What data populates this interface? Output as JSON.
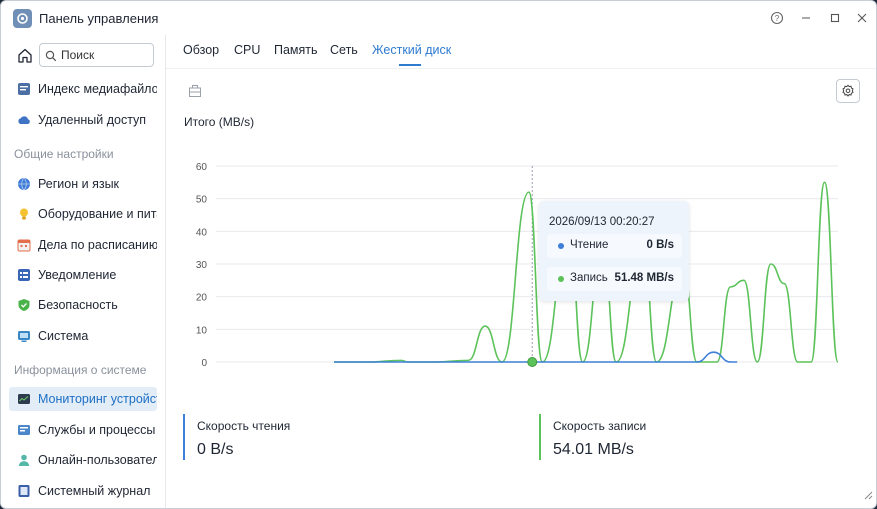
{
  "window": {
    "title": "Панель управления"
  },
  "search": {
    "placeholder": "Поиск"
  },
  "sidebar": {
    "top_items": [
      {
        "label": "Индекс медиафайлов",
        "icon": "media-index-icon"
      },
      {
        "label": "Удаленный доступ",
        "icon": "cloud-icon"
      }
    ],
    "sections": [
      {
        "header": "Общие настройки",
        "items": [
          {
            "label": "Регион и язык",
            "icon": "globe-icon"
          },
          {
            "label": "Оборудование и питание",
            "icon": "lightbulb-icon"
          },
          {
            "label": "Дела по расписанию",
            "icon": "calendar-icon"
          },
          {
            "label": "Уведомление",
            "icon": "notification-icon"
          },
          {
            "label": "Безопасность",
            "icon": "shield-icon"
          },
          {
            "label": "Система",
            "icon": "system-icon"
          }
        ]
      },
      {
        "header": "Информация о системе",
        "items": [
          {
            "label": "Мониторинг устройства",
            "icon": "monitor-icon",
            "active": true
          },
          {
            "label": "Службы и процессы",
            "icon": "services-icon"
          },
          {
            "label": "Онлайн-пользователи",
            "icon": "users-icon"
          },
          {
            "label": "Системный журнал",
            "icon": "log-icon"
          }
        ]
      }
    ]
  },
  "tabs": [
    {
      "label": "Обзор"
    },
    {
      "label": "CPU"
    },
    {
      "label": "Память"
    },
    {
      "label": "Сеть"
    },
    {
      "label": "Жесткий диск",
      "active": true
    }
  ],
  "chart_title": "Итого (MB/s)",
  "tooltip": {
    "time": "2026/09/13 00:20:27",
    "read_label": "Чтение",
    "read_value": "0 B/s",
    "write_label": "Запись",
    "write_value": "51.48 MB/s"
  },
  "stats": {
    "read_label": "Скорость чтения",
    "read_value": "0 B/s",
    "write_label": "Скорость записи",
    "write_value": "54.01 MB/s"
  },
  "colors": {
    "accent": "#2f7bd0",
    "read_series": "#3d7fd9",
    "write_series": "#5cc25a"
  },
  "chart_data": {
    "type": "line",
    "ylim": [
      0,
      60
    ],
    "yticks": [
      "60",
      "50",
      "40",
      "30",
      "20",
      "10",
      "0"
    ],
    "grid": true,
    "series": [
      {
        "name": "Чтение",
        "color": "#3d7fd9",
        "points": [
          [
            0,
            0
          ],
          [
            12,
            0
          ],
          [
            24,
            0
          ],
          [
            36,
            0
          ],
          [
            48,
            0
          ],
          [
            60,
            0
          ],
          [
            72,
            0
          ],
          [
            84,
            0
          ],
          [
            96,
            0
          ],
          [
            108,
            0
          ],
          [
            113,
            3
          ],
          [
            118,
            0
          ],
          [
            120,
            0
          ]
        ]
      },
      {
        "name": "Запись",
        "color": "#5cc25a",
        "points": [
          [
            0,
            0
          ],
          [
            10,
            0
          ],
          [
            20,
            0.5
          ],
          [
            22,
            0
          ],
          [
            30,
            0
          ],
          [
            40,
            0.5
          ],
          [
            45,
            11
          ],
          [
            50,
            0
          ],
          [
            58,
            52
          ],
          [
            62,
            0
          ],
          [
            70,
            40
          ],
          [
            74,
            0
          ],
          [
            80,
            36
          ],
          [
            84,
            0
          ],
          [
            92,
            35
          ],
          [
            96,
            0
          ],
          [
            104,
            29
          ],
          [
            108,
            0
          ],
          [
            114,
            0
          ],
          [
            118,
            23
          ],
          [
            122,
            25
          ],
          [
            126,
            0
          ],
          [
            130,
            30
          ],
          [
            134,
            24
          ],
          [
            138,
            0
          ],
          [
            142,
            0
          ],
          [
            146,
            55
          ],
          [
            150,
            0
          ]
        ]
      }
    ],
    "cursor_x": 59
  }
}
